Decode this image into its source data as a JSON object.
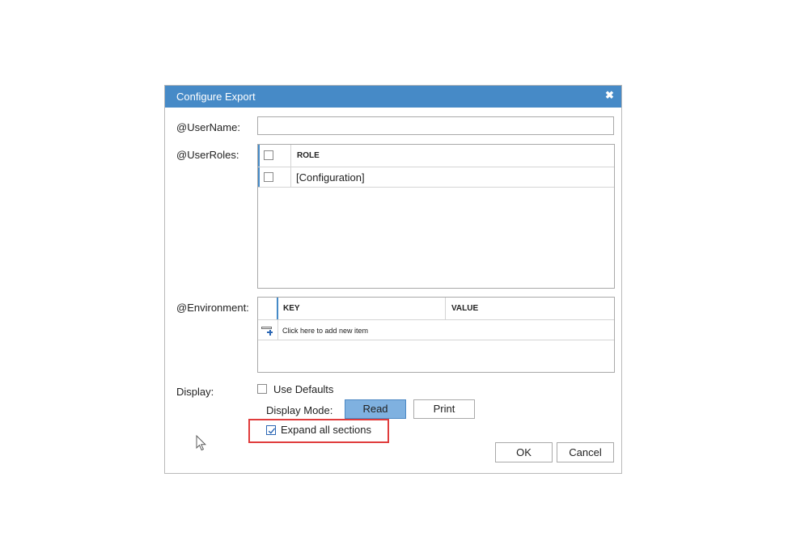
{
  "dialog": {
    "title": "Configure Export",
    "close_icon": "close-icon"
  },
  "username": {
    "label": "@UserName:",
    "value": ""
  },
  "user_roles": {
    "label": "@UserRoles:",
    "columns": [
      "ROLE"
    ],
    "header_checked": false,
    "rows": [
      {
        "role": "[Configuration]",
        "checked": false
      }
    ]
  },
  "environment": {
    "label": "@Environment:",
    "columns": [
      "KEY",
      "VALUE"
    ],
    "add_row_text": "Click here to add new item",
    "add_icon": "add-row-icon"
  },
  "display": {
    "label": "Display:",
    "use_defaults_label": "Use Defaults",
    "use_defaults_checked": false,
    "mode_label": "Display Mode:",
    "modes": [
      "Read",
      "Print"
    ],
    "selected_mode": "Read",
    "expand_label": "Expand all sections",
    "expand_checked": true
  },
  "buttons": {
    "ok": "OK",
    "cancel": "Cancel"
  },
  "colors": {
    "titlebar": "#468ac7",
    "selected_mode": "#7fb1e0",
    "highlight": "#e03c3c"
  }
}
